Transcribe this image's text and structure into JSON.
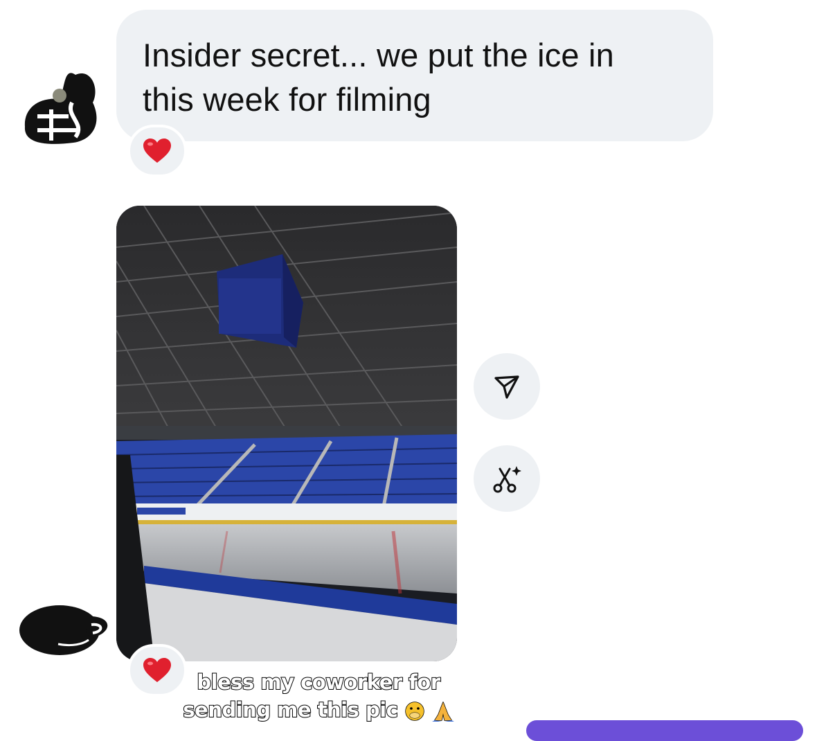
{
  "message": {
    "text": "Insider secret... we put the ice in\nthis week for filming",
    "reaction": "heart"
  },
  "photo": {
    "description_icon": "arena-photo",
    "reaction": "heart"
  },
  "actions": {
    "share": "share-icon",
    "edit": "scissors-sparkle-icon"
  },
  "caption": {
    "line1": "bless my coworker for",
    "line2": "sending me this pic"
  },
  "colors": {
    "bubble": "#eef1f4",
    "accent": "#6c4fd8",
    "heart": "#e0202e"
  }
}
